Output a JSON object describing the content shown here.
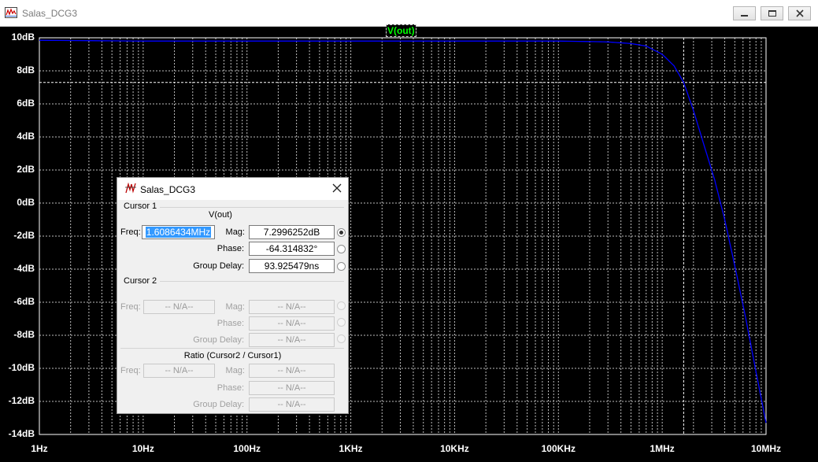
{
  "window": {
    "title": "Salas_DCG3"
  },
  "plot": {
    "trace_label": "V(out)",
    "y_ticks": [
      "10dB",
      "8dB",
      "6dB",
      "4dB",
      "2dB",
      "0dB",
      "-2dB",
      "-4dB",
      "-6dB",
      "-8dB",
      "-10dB",
      "-12dB",
      "-14dB"
    ],
    "x_ticks": [
      "1Hz",
      "10Hz",
      "100Hz",
      "1KHz",
      "10KHz",
      "100KHz",
      "1MHz",
      "10MHz"
    ],
    "grid": true,
    "trace_color": "#0000ff",
    "cursor_color": "#ffffff"
  },
  "chart_data": {
    "type": "line",
    "x_scale": "log",
    "xlim_hz": [
      1,
      10000000
    ],
    "ylim_db": [
      -14,
      10
    ],
    "series": [
      {
        "name": "V(out)",
        "x": [
          1,
          10,
          100,
          1000,
          10000,
          100000,
          300000,
          500000,
          700000,
          1000000,
          1300000,
          1608643.4,
          2000000,
          2500000,
          3200000,
          4000000,
          5000000,
          6300000,
          8000000,
          10000000
        ],
        "y": [
          9.85,
          9.8,
          9.8,
          9.8,
          9.8,
          9.8,
          9.75,
          9.65,
          9.5,
          9.0,
          8.3,
          7.3,
          5.6,
          3.6,
          1.4,
          -1.0,
          -3.8,
          -6.8,
          -10.2,
          -13.3
        ]
      }
    ],
    "cursor1": {
      "freq_hz": 1608643.4,
      "mag_db": 7.2996252
    }
  },
  "dialog": {
    "title": "Salas_DCG3",
    "cursor1": {
      "heading": "Cursor 1",
      "trace": "V(out)",
      "freq_label": "Freq:",
      "freq": "1.6086434MHz",
      "mag_label": "Mag:",
      "mag": "7.2996252dB",
      "phase_label": "Phase:",
      "phase": "-64.314832°",
      "gd_label": "Group Delay:",
      "gd": "93.925479ns"
    },
    "cursor2": {
      "heading": "Cursor 2",
      "freq_label": "Freq:",
      "freq": "-- N/A--",
      "mag_label": "Mag:",
      "mag": "-- N/A--",
      "phase_label": "Phase:",
      "phase": "-- N/A--",
      "gd_label": "Group Delay:",
      "gd": "-- N/A--"
    },
    "ratio": {
      "heading": "Ratio (Cursor2 / Cursor1)",
      "freq_label": "Freq:",
      "freq": "-- N/A--",
      "mag_label": "Mag:",
      "mag": "-- N/A--",
      "phase_label": "Phase:",
      "phase": "-- N/A--",
      "gd_label": "Group Delay:",
      "gd": "-- N/A--"
    }
  }
}
